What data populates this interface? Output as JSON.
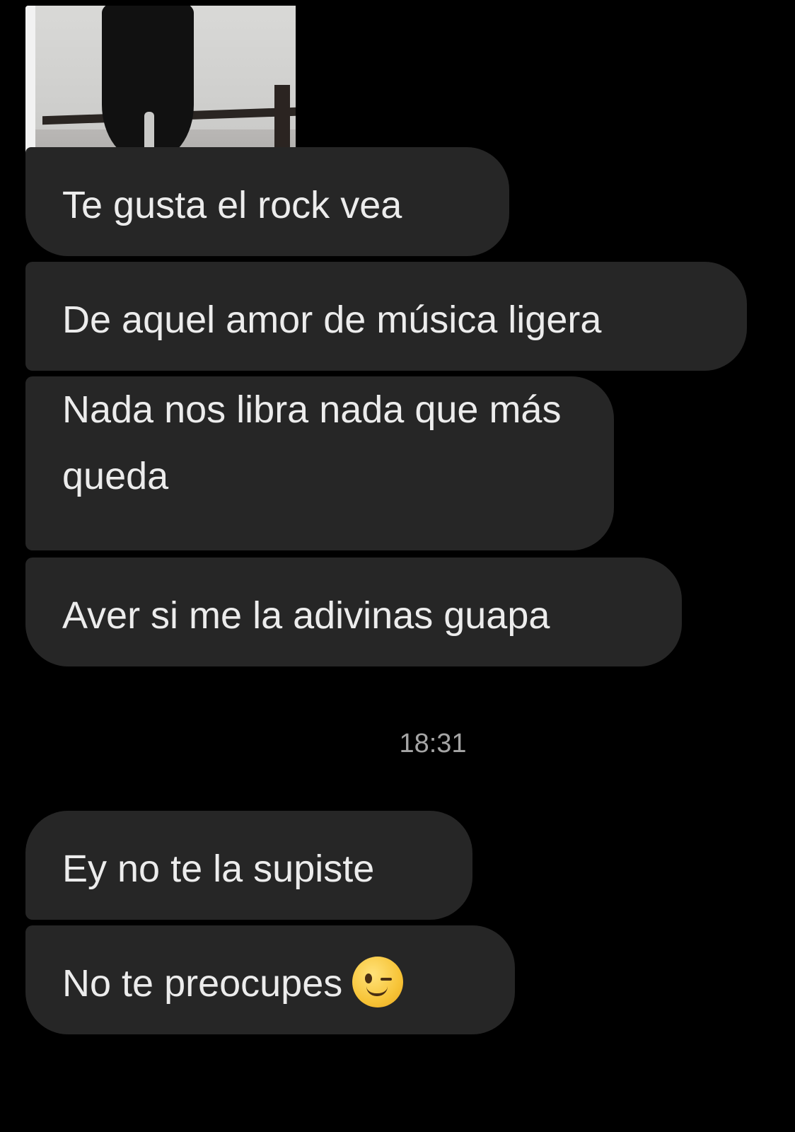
{
  "conversation": {
    "messages": [
      {
        "text": "Te gusta el rock vea"
      },
      {
        "text": "De aquel amor de música ligera"
      },
      {
        "text": "Nada nos libra nada que más queda"
      },
      {
        "text": "Aver si me la adivinas guapa"
      },
      {
        "text": "Ey no te la supiste"
      },
      {
        "text": "No te preocupes",
        "emoji": "winking-face-emoji"
      }
    ],
    "separator_time": "18:31"
  },
  "colors": {
    "background": "#000000",
    "bubble": "#262626",
    "text": "#ececec",
    "timestamp": "#a5a5a5"
  }
}
